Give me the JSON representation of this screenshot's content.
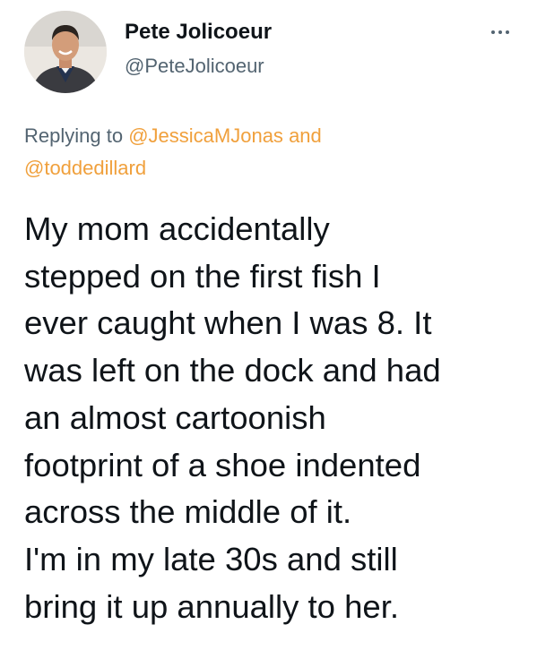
{
  "author": {
    "display_name": "Pete Jolicoeur",
    "handle": "@PeteJolicoeur"
  },
  "reply_context": {
    "prefix": "Replying to",
    "mention_1": "@JessicaMJonas",
    "connector": "and",
    "mention_2": "@toddedillard"
  },
  "tweet": {
    "lines": [
      "My mom accidentally",
      "stepped on the first fish I",
      "ever caught when I was 8. It",
      "was left on the dock and had",
      "an almost cartoonish",
      "footprint of a shoe indented",
      "across the middle of it.",
      "I'm in my late 30s and still",
      "bring it up annually to her."
    ]
  },
  "icons": {
    "more": "more-horizontal-icon",
    "avatar": "profile-photo"
  },
  "colors": {
    "name": "#0f1419",
    "secondary": "#536471",
    "mention": "#f0a03c",
    "body": "#0f1419"
  }
}
